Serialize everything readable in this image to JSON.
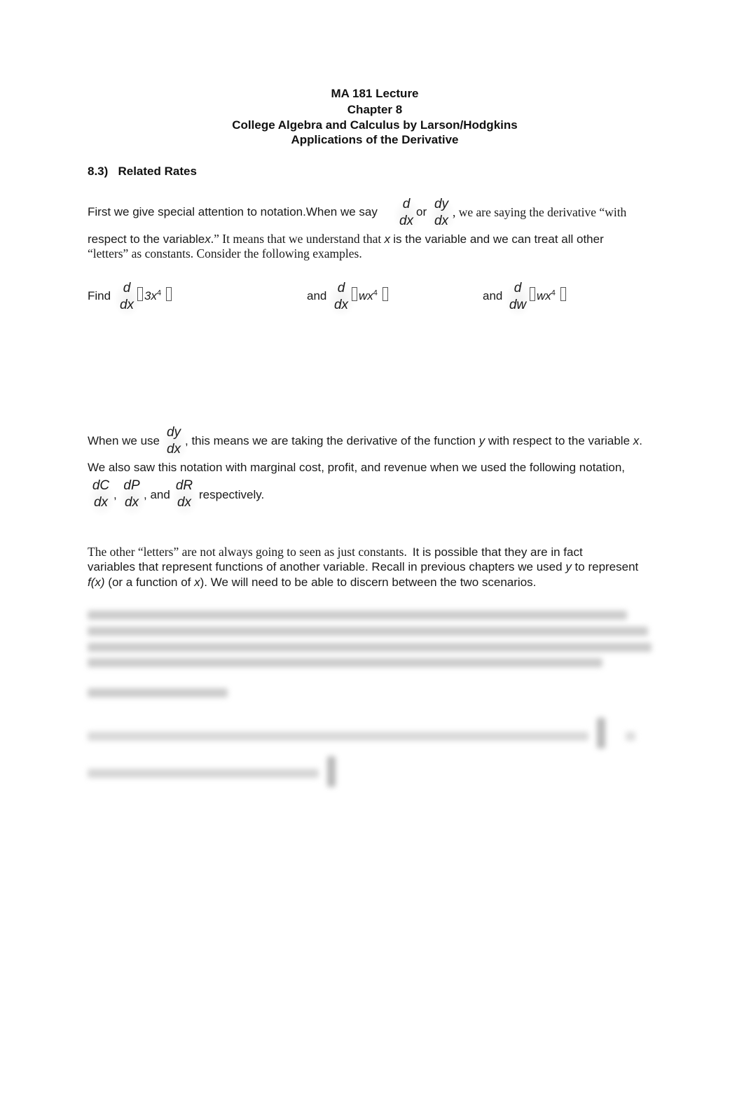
{
  "header": {
    "line1": "MA 181 Lecture",
    "line2": "Chapter 8",
    "line3": "College Algebra and Calculus by Larson/Hodgkins",
    "line4": "Applications of the Derivative"
  },
  "section": {
    "number": "8.3)",
    "title": "Related Rates"
  },
  "para1": {
    "a": "First we give special attention to notation.",
    "b": "When we say",
    "frac1_num": "d",
    "frac1_den": "dx",
    "or": "or",
    "frac2_num": "dy",
    "frac2_den": "dx",
    "c": ", we are saying the derivative “with",
    "line2_a": "respect to the variable",
    "line2_x": "x",
    "line2_b": ".”  It means that we understand that",
    "line2_x2": "x",
    "line2_c": "is the variable and we can treat all other",
    "line3": "“letters” as constants.  Consider the following examples."
  },
  "examples": [
    {
      "lead": "Find",
      "num": "d",
      "den": "dx",
      "expr": "3x",
      "exp": "4"
    },
    {
      "lead": "and",
      "num": "d",
      "den": "dx",
      "expr": "wx",
      "exp": "4"
    },
    {
      "lead": "and",
      "num": "d",
      "den": "dw",
      "expr": "wx",
      "exp": "4"
    }
  ],
  "para2": {
    "a": "When we use",
    "frac_num": "dy",
    "frac_den": "dx",
    "b": ", this means we are taking the derivative of the function",
    "y": "y",
    "c": "with respect to the variable",
    "x": "x",
    "d": ".",
    "line2": "We also saw this notation with marginal cost, profit, and revenue when we used the following notation,",
    "fracs": [
      {
        "num": "dC",
        "den": "dx"
      },
      {
        "num": "dP",
        "den": "dx"
      },
      {
        "num": "dR",
        "den": "dx"
      }
    ],
    "comma": ",",
    "comma_and": ", and",
    "respectively": "respectively."
  },
  "para3": {
    "line1_serif": "The other “letters” are not always going to seen as just constants.",
    "line1_sans": "It is possible that they are in fact",
    "line2_a": "variables that represent functions of another variable.",
    "line2_b": "Recall in previous chapters we used",
    "line2_y": "y",
    "line2_c": "to represent",
    "line3_fx": "f(x)",
    "line3_a": "(or a function of",
    "line3_x": "x",
    "line3_b": ").  We will need to be able to discern between the two scenarios."
  }
}
